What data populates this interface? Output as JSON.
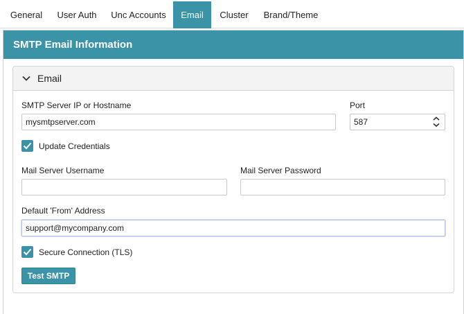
{
  "tabs": [
    {
      "label": "General"
    },
    {
      "label": "User Auth"
    },
    {
      "label": "Unc Accounts"
    },
    {
      "label": "Email",
      "active": true
    },
    {
      "label": "Cluster"
    },
    {
      "label": "Brand/Theme"
    }
  ],
  "panel": {
    "title": "SMTP Email Information"
  },
  "section": {
    "title": "Email"
  },
  "form": {
    "smtp_server_label": "SMTP Server IP or Hostname",
    "smtp_server_value": "mysmtpserver.com",
    "port_label": "Port",
    "port_value": "587",
    "update_credentials_label": "Update Credentials",
    "update_credentials_checked": true,
    "username_label": "Mail Server Username",
    "username_value": "",
    "password_label": "Mail Server Password",
    "password_value": "",
    "from_label": "Default 'From' Address",
    "from_value": "support@mycompany.com",
    "tls_label": "Secure Connection (TLS)",
    "tls_checked": true,
    "test_button": "Test SMTP"
  },
  "colors": {
    "accent": "#3a93a6",
    "section_bg": "#f3f3f3",
    "border": "#d5d5d5"
  },
  "icons": [
    "chevron-down-icon",
    "checkmark-icon",
    "spinner-up-icon",
    "spinner-down-icon"
  ]
}
